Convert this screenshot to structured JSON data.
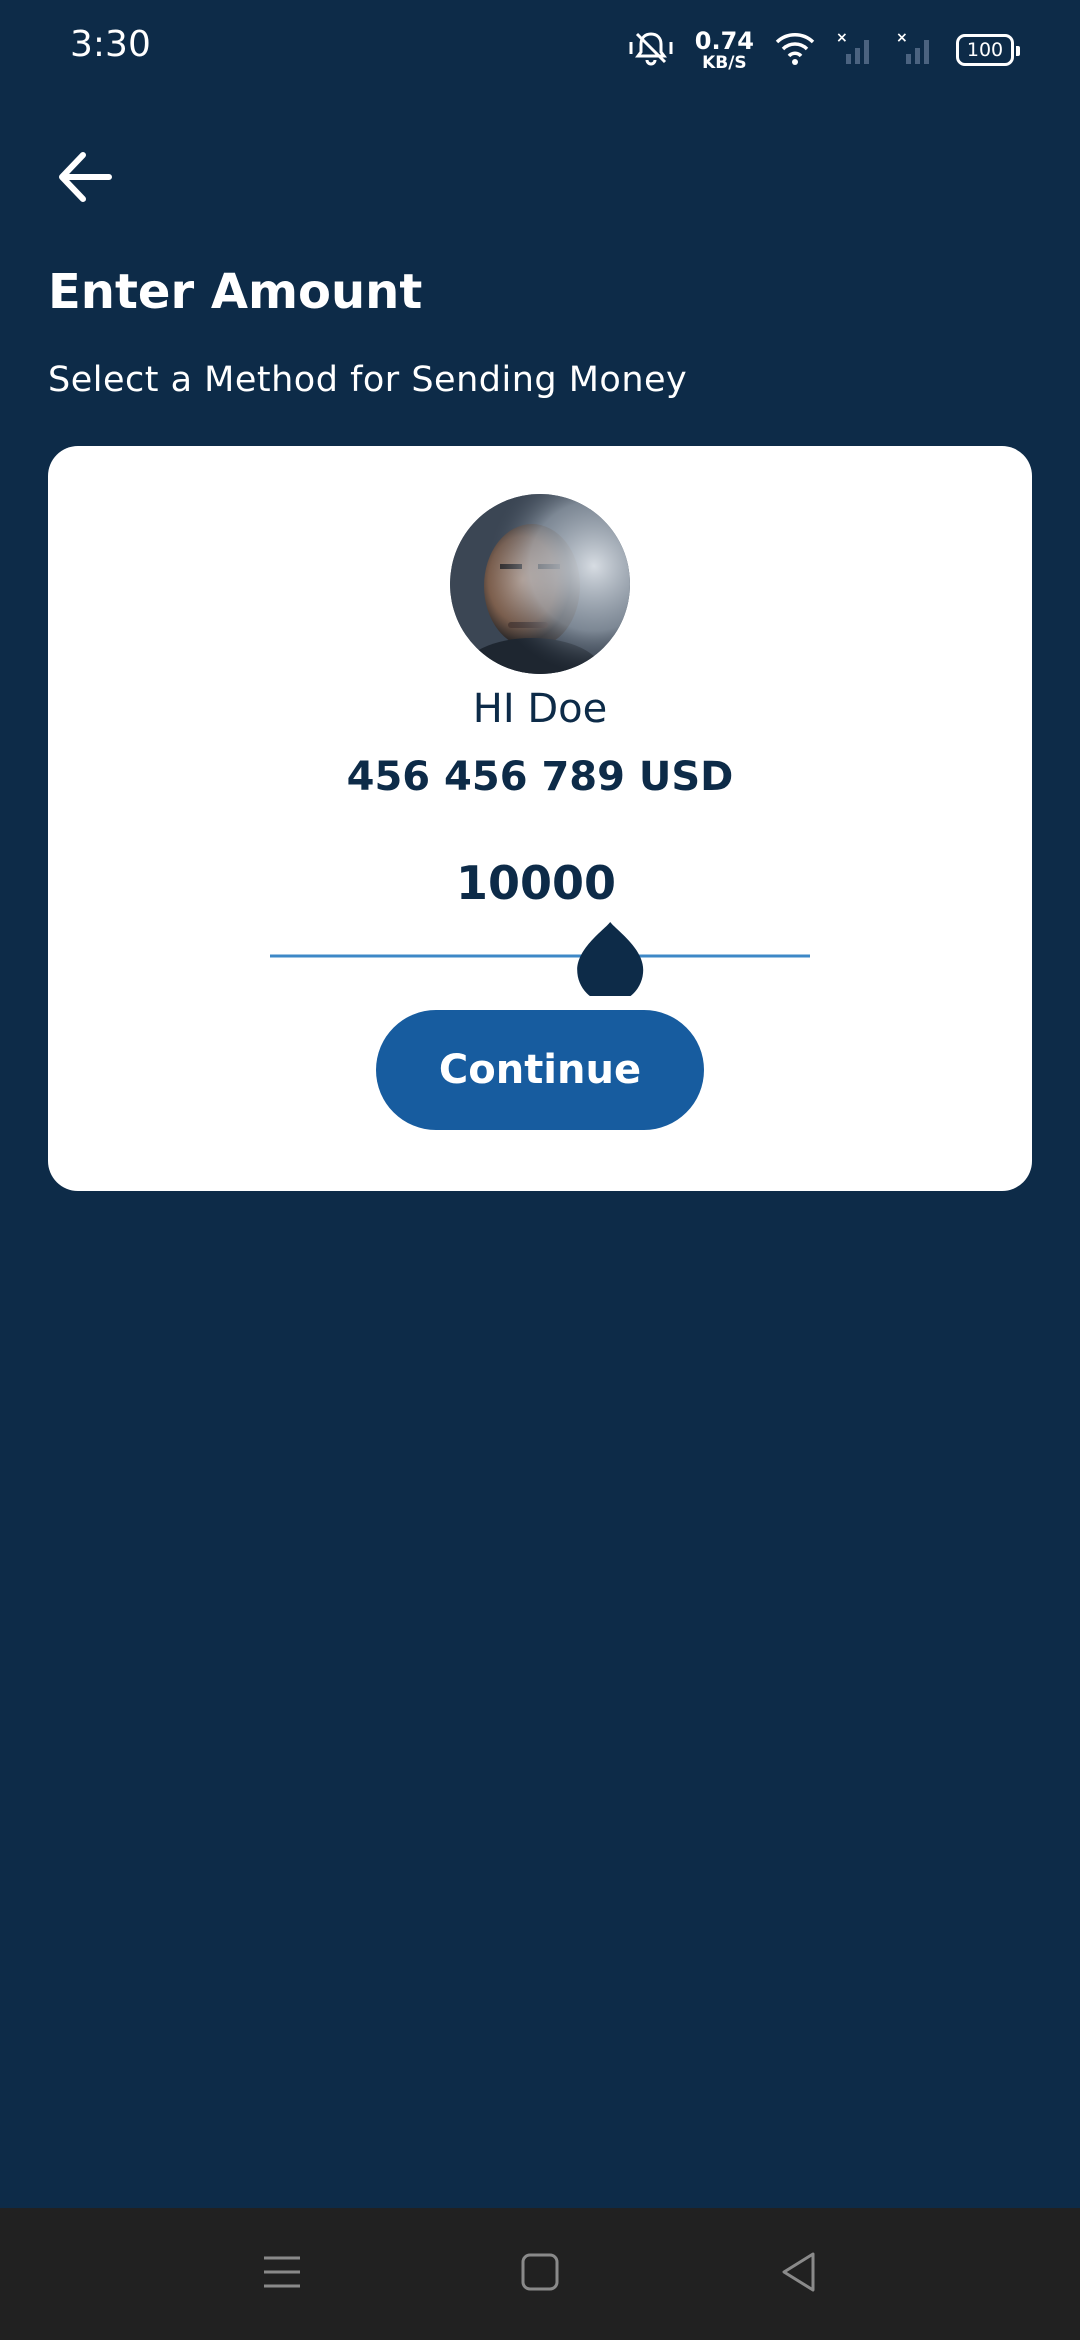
{
  "status_bar": {
    "time": "3:30",
    "net_speed_value": "0.74",
    "net_speed_unit": "KB/S",
    "battery": "100",
    "icons": [
      "mute-bell-icon",
      "wifi-icon",
      "signal-icon",
      "signal-icon"
    ]
  },
  "header": {
    "back_icon": "arrow-left-icon",
    "title": "Enter Amount",
    "subtitle": "Select a Method for Sending Money"
  },
  "card": {
    "recipient_name": "HI Doe",
    "account": "456 456 789 USD",
    "amount": "10000",
    "slider_level_fraction": 0.63,
    "continue_label": "Continue"
  },
  "nav": {
    "icons": [
      "menu-icon",
      "home-square-icon",
      "back-triangle-icon"
    ]
  },
  "colors": {
    "background": "#0d2b48",
    "card": "#ffffff",
    "primary_button": "#175c9f",
    "slider_track": "#3e88c7",
    "nav_bar": "#212121"
  }
}
